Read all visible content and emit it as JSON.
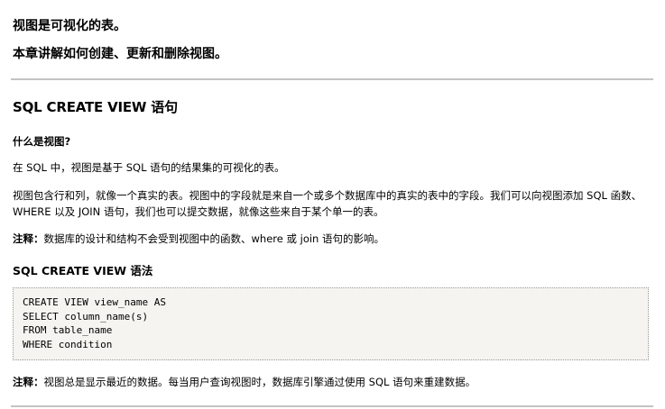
{
  "intro": {
    "line1": "视图是可视化的表。",
    "line2": "本章讲解如何创建、更新和删除视图。"
  },
  "section": {
    "title": "SQL CREATE VIEW 语句",
    "subheading": "什么是视图?",
    "paragraph1": "在 SQL 中，视图是基于 SQL 语句的结果集的可视化的表。",
    "paragraph2": "视图包含行和列，就像一个真实的表。视图中的字段就是来自一个或多个数据库中的真实的表中的字段。我们可以向视图添加 SQL 函数、WHERE 以及 JOIN 语句，我们也可以提交数据，就像这些来自于某个单一的表。",
    "note1": {
      "label": "注释：",
      "text": "数据库的设计和结构不会受到视图中的函数、where 或 join 语句的影响。"
    },
    "syntax_heading": "SQL CREATE VIEW 语法",
    "code": [
      "CREATE VIEW view_name AS",
      "SELECT column_name(s)",
      "FROM table_name",
      "WHERE condition"
    ],
    "note2": {
      "label": "注释：",
      "text": "视图总是显示最近的数据。每当用户查询视图时，数据库引擎通过使用 SQL 语句来重建数据。"
    }
  }
}
